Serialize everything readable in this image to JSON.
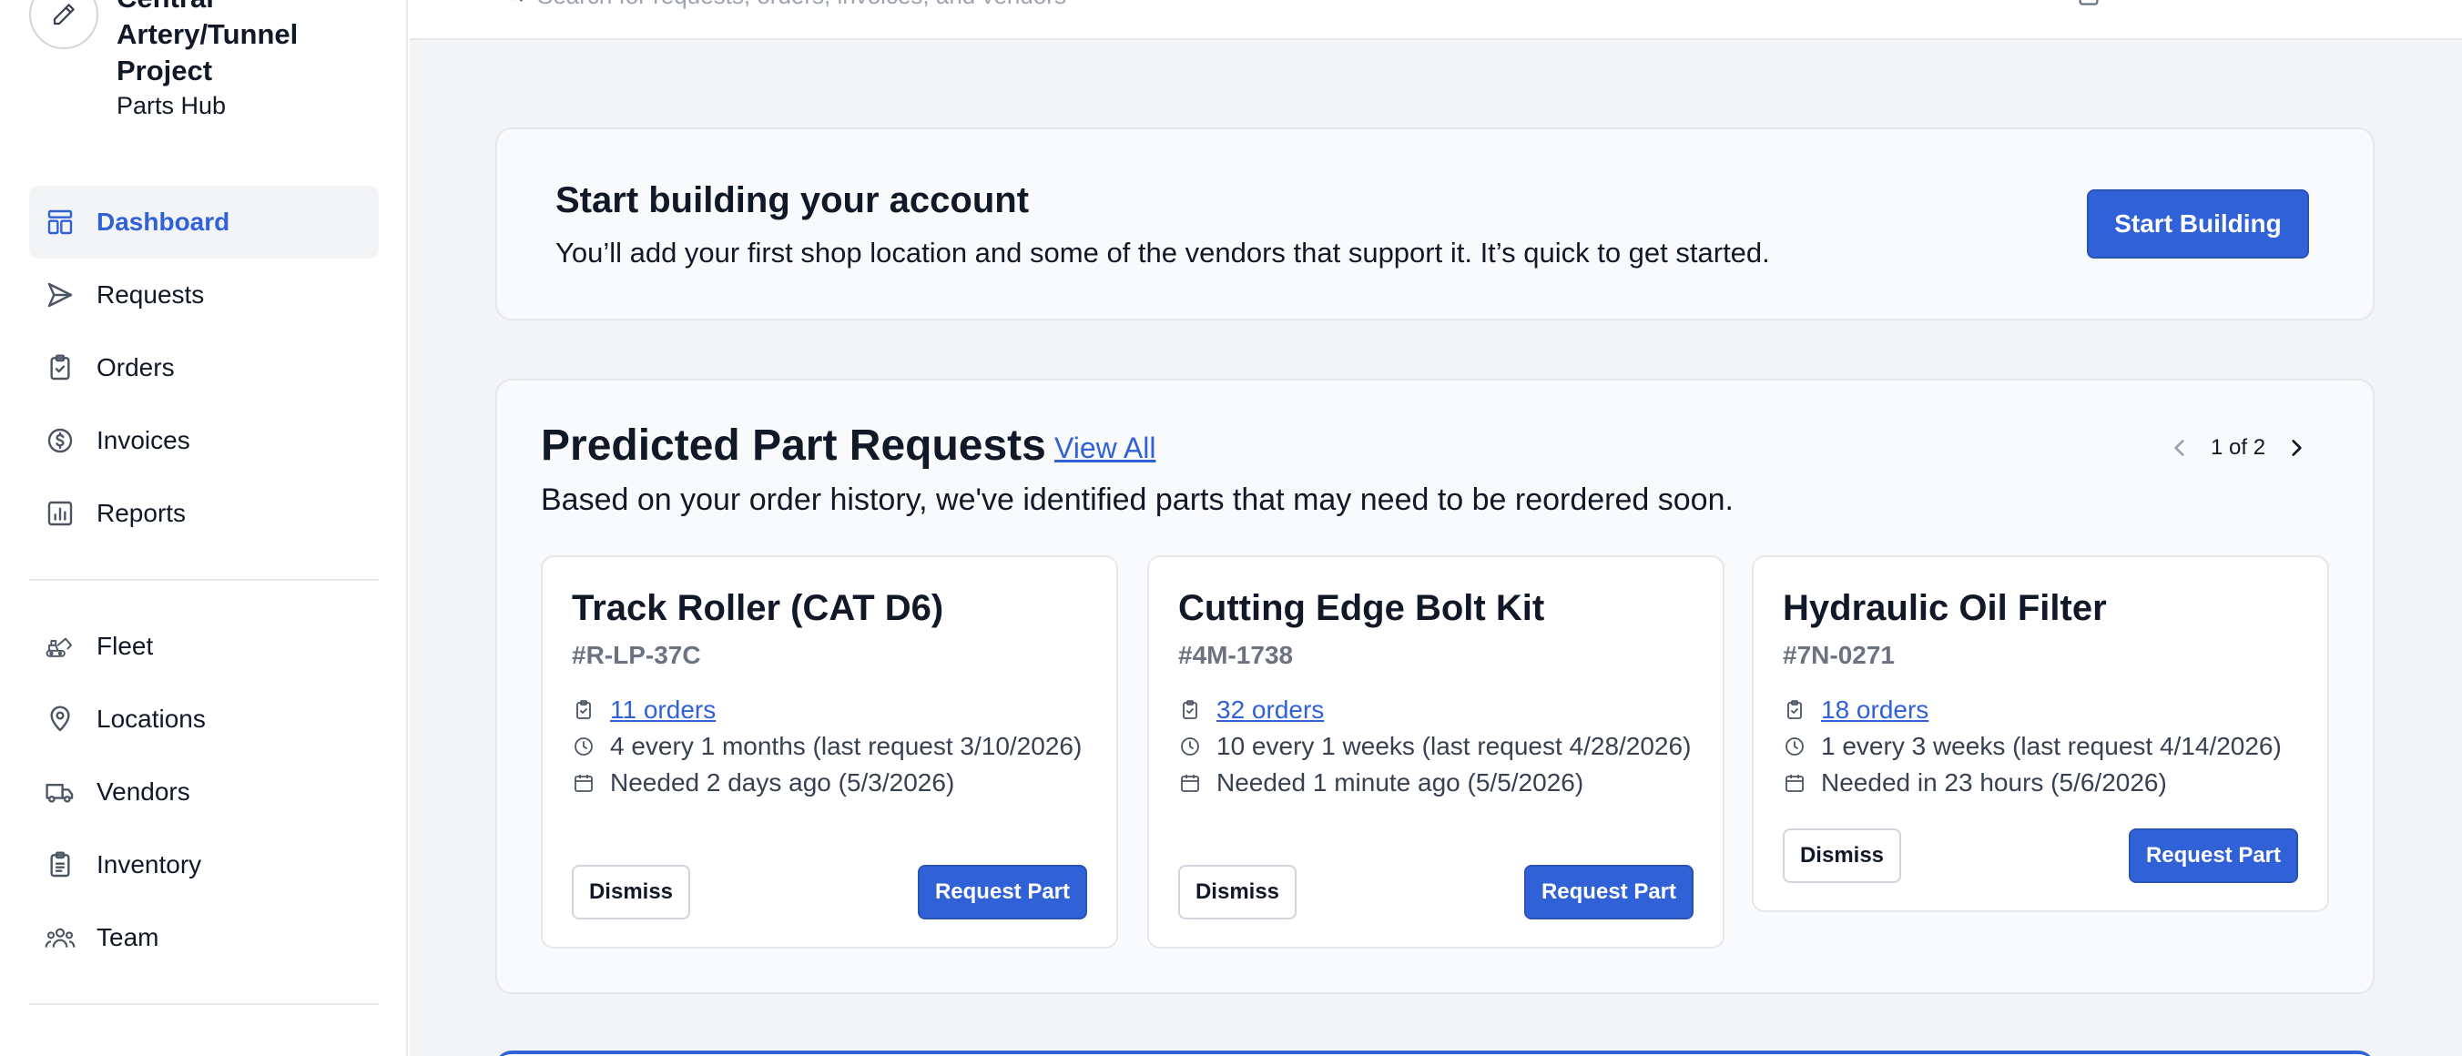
{
  "brand": {
    "title": "Central Artery/Tunnel Project",
    "subtitle": "Parts Hub",
    "icon": "pencil-icon"
  },
  "sidebar": {
    "primary": [
      {
        "label": "Dashboard",
        "icon": "dashboard-icon",
        "active": true
      },
      {
        "label": "Requests",
        "icon": "send-icon"
      },
      {
        "label": "Orders",
        "icon": "clipboard-check-icon"
      },
      {
        "label": "Invoices",
        "icon": "dollar-circle-icon"
      },
      {
        "label": "Reports",
        "icon": "bar-chart-icon"
      }
    ],
    "secondary": [
      {
        "label": "Fleet",
        "icon": "excavator-icon"
      },
      {
        "label": "Locations",
        "icon": "map-pin-icon"
      },
      {
        "label": "Vendors",
        "icon": "truck-icon"
      },
      {
        "label": "Inventory",
        "icon": "clipboard-list-icon"
      },
      {
        "label": "Team",
        "icon": "team-icon"
      }
    ]
  },
  "topbar": {
    "search_placeholder": "Search for requests, orders, invoices, and vendors"
  },
  "banner": {
    "title": "Start building your account",
    "description": "You’ll add your first shop location and some of the vendors that support it. It’s quick to get started.",
    "button": "Start Building"
  },
  "predicted": {
    "title": "Predicted Part Requests",
    "view_all": "View All",
    "description": "Based on your order history, we've identified parts that may need to be reordered soon.",
    "pager": "1 of 2",
    "dismiss_label": "Dismiss",
    "request_label": "Request Part",
    "parts": [
      {
        "name": "Track Roller (CAT D6)",
        "number": "#R-LP-37C",
        "orders": "11 orders",
        "frequency": "4 every 1 months (last request 3/10/2026)",
        "needed": "Needed 2 days ago (5/3/2026)"
      },
      {
        "name": "Cutting Edge Bolt Kit",
        "number": "#4M-1738",
        "orders": "32 orders",
        "frequency": "10 every 1 weeks (last request 4/28/2026)",
        "needed": "Needed 1 minute ago (5/5/2026)"
      },
      {
        "name": "Hydraulic Oil Filter",
        "number": "#7N-0271",
        "orders": "18 orders",
        "frequency": "1 every 3 weeks (last request 4/14/2026)",
        "needed": "Needed in 23 hours (5/6/2026)"
      }
    ]
  },
  "colors": {
    "accent": "#3161d6",
    "page_bg": "#f3f4f6",
    "card_bg": "#f9fafb",
    "border": "#e5e7eb"
  }
}
